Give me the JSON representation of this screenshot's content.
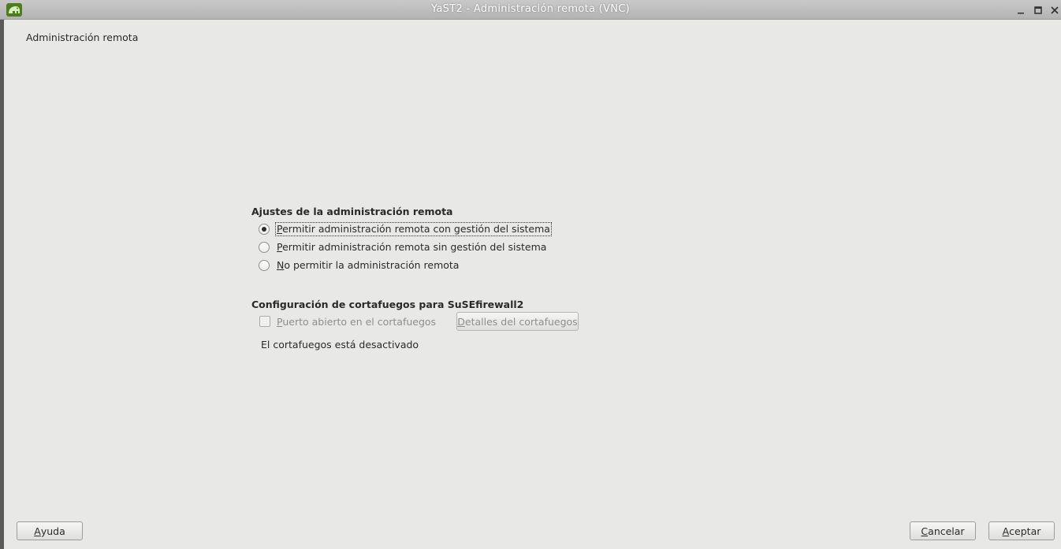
{
  "window": {
    "title": "YaST2 - Administración remota (VNC)"
  },
  "page": {
    "heading": "Administración remota"
  },
  "remote_settings": {
    "title": "Ajustes de la administración remota",
    "options": [
      {
        "mnemonic": "P",
        "label_rest": "ermitir administración remota con gestión del sistema",
        "selected": true
      },
      {
        "mnemonic": "P",
        "label_rest": "ermitir administración remota sin gestión del sistema",
        "selected": false
      },
      {
        "mnemonic": "N",
        "label_rest": "o permitir la administración remota",
        "selected": false
      }
    ]
  },
  "firewall": {
    "title": "Configuración de cortafuegos para SuSEfirewall2",
    "open_port": {
      "mnemonic": "P",
      "label_rest": "uerto abierto en el cortafuegos",
      "checked": false,
      "enabled": false
    },
    "details_button": {
      "mnemonic": "D",
      "label_rest": "etalles del cortafuegos",
      "enabled": false
    },
    "status": "El cortafuegos está desactivado"
  },
  "buttons": {
    "help": {
      "mnemonic": "A",
      "label_rest": "yuda"
    },
    "cancel": {
      "mnemonic": "C",
      "label_rest": "ancelar"
    },
    "accept": {
      "mnemonic": "A",
      "label_rest": "ceptar"
    }
  },
  "icons": {
    "app": "yast-chameleon-icon",
    "minimize": "minimize-icon",
    "maximize": "maximize-icon",
    "close": "close-icon"
  },
  "colors": {
    "window_bg": "#e8e8e7",
    "titlebar": "#bdbdbd",
    "app_icon_green": "#73ba25"
  }
}
